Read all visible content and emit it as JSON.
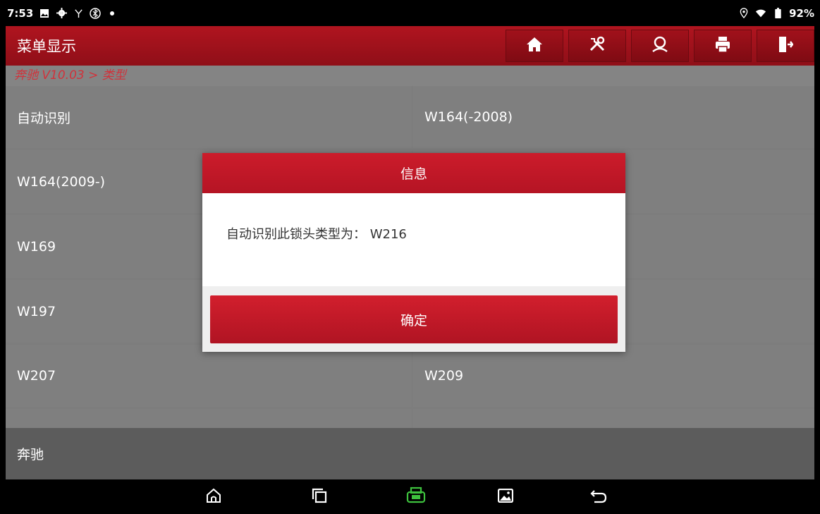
{
  "status_bar": {
    "time": "7:53",
    "battery": "92%"
  },
  "header": {
    "title": "菜单显示",
    "tools": [
      {
        "icon": "home-icon"
      },
      {
        "icon": "tools-icon"
      },
      {
        "icon": "user-icon"
      },
      {
        "icon": "print-icon"
      },
      {
        "icon": "exit-icon"
      }
    ]
  },
  "breadcrumb": "奔驰 V10.03 > 类型",
  "menu": {
    "items": [
      "自动识别",
      "W164(-2008)",
      "W164(2009-)",
      "",
      "W169",
      "",
      "W197",
      "",
      "W207",
      "W209"
    ]
  },
  "footer": {
    "label": "奔驰"
  },
  "dialog": {
    "title": "信息",
    "message": "自动识别此锁头类型为： W216",
    "ok_label": "确定"
  },
  "nav": {
    "buttons": [
      "home-icon",
      "recent-apps-icon",
      "vci-icon",
      "gallery-icon",
      "back-icon"
    ]
  },
  "colors": {
    "brand_red": "#b0141f",
    "vci_green": "#3ec23e"
  }
}
